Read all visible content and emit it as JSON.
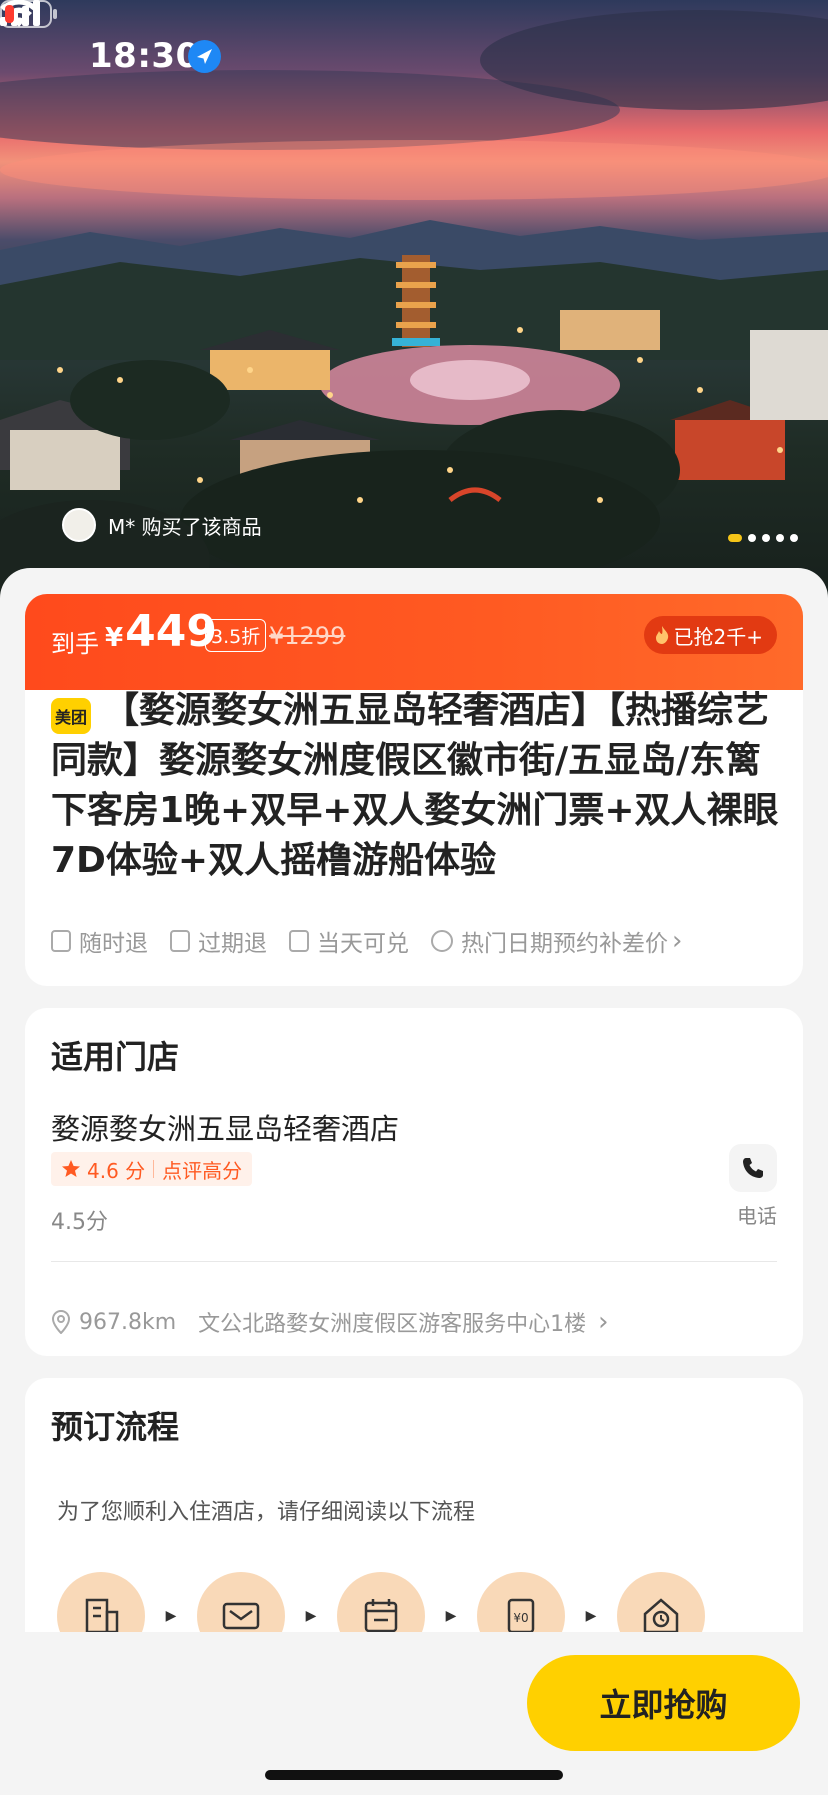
{
  "status_bar": {
    "time": "18:30"
  },
  "hero": {
    "buyer_text": "M* 购买了该商品",
    "carousel_count": 5,
    "carousel_active": 0
  },
  "price": {
    "label": "到手",
    "currency": "¥",
    "value": "449",
    "discount": "3.5折",
    "original": "¥1299",
    "hot_badge": "已抢2千+"
  },
  "product": {
    "brand_logo_text": "美团",
    "title": "【婺源婺女洲五显岛轻奢酒店】【热播综艺同款】婺源婺女洲度假区徽市街/五显岛/东篱下客房1晚+双早+双人婺女洲门票+双人裸眼7D体验+双人摇橹游船体验",
    "tags": [
      "随时退",
      "过期退",
      "当天可兑",
      "热门日期预约补差价"
    ]
  },
  "store": {
    "section_title": "适用门店",
    "name": "婺源婺女洲五显岛轻奢酒店",
    "rating_score": "4.6 分",
    "rating_label": "点评高分",
    "score_text": "4.5分",
    "phone_label": "电话",
    "distance": "967.8km",
    "address": "文公北路婺女洲度假区游客服务中心1楼"
  },
  "process": {
    "section_title": "预订流程",
    "note": "为了您顺利入住酒店，请仔细阅读以下流程"
  },
  "buy_button": "立即抢购",
  "colors": {
    "accent": "#ff4a1c",
    "brand_yellow": "#ffd000"
  },
  "icons": [
    "location-arrow-icon",
    "signal-icon",
    "wifi-icon",
    "battery-icon",
    "fire-icon",
    "star-icon",
    "phone-icon",
    "map-pin-icon",
    "chevron-right-icon"
  ]
}
